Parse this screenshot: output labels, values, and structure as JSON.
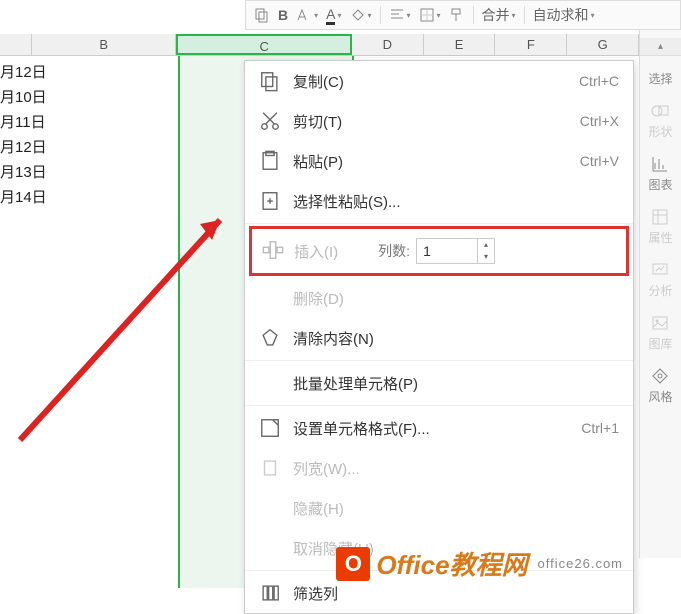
{
  "toolbar": {
    "merge_label": "合并",
    "autosum_label": "自动求和"
  },
  "columns": {
    "B": "B",
    "C": "C",
    "D": "D",
    "E": "E",
    "F": "F",
    "G": "G"
  },
  "dates": [
    "月12日",
    "月10日",
    "月11日",
    "月12日",
    "月13日",
    "月14日"
  ],
  "menu": {
    "copy": {
      "label": "复制(C)",
      "shortcut": "Ctrl+C"
    },
    "cut": {
      "label": "剪切(T)",
      "shortcut": "Ctrl+X"
    },
    "paste": {
      "label": "粘贴(P)",
      "shortcut": "Ctrl+V"
    },
    "paste_special": {
      "label": "选择性粘贴(S)..."
    },
    "insert": {
      "label": "插入(I)",
      "count_label": "列数:",
      "count_value": "1"
    },
    "delete": {
      "label": "删除(D)"
    },
    "clear": {
      "label": "清除内容(N)"
    },
    "batch": {
      "label": "批量处理单元格(P)"
    },
    "format": {
      "label": "设置单元格格式(F)...",
      "shortcut": "Ctrl+1"
    },
    "col_width": {
      "label": "列宽(W)..."
    },
    "hide": {
      "label": "隐藏(H)"
    },
    "unhide": {
      "label": "取消隐藏(U)"
    },
    "filter": {
      "label": "筛选列"
    }
  },
  "sidebar": {
    "select": "选择",
    "shape": "形状",
    "chart": "图表",
    "property": "属性",
    "analyze": "分析",
    "gallery": "图库",
    "style": "风格"
  },
  "watermark": {
    "text": "Office教程网",
    "sub": "office26.com"
  }
}
